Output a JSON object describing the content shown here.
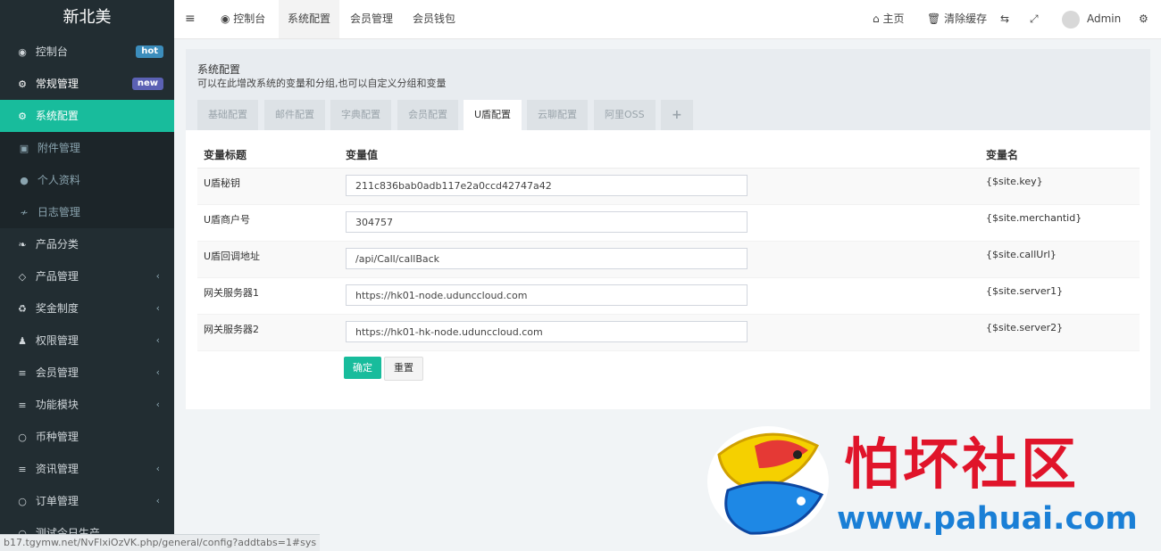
{
  "sidebar": {
    "logo": "新北美",
    "items": [
      {
        "icon": "dashboard-icon",
        "glyph": "◉",
        "label": "控制台",
        "badge": "hot"
      },
      {
        "icon": "cogs-icon",
        "glyph": "⚙",
        "label": "常规管理",
        "badge": "new"
      },
      {
        "icon": "gear-icon",
        "glyph": "⚙",
        "label": "系统配置"
      },
      {
        "icon": "file-image-icon",
        "glyph": "▣",
        "label": "附件管理"
      },
      {
        "icon": "user-icon",
        "glyph": "●",
        "label": "个人资料"
      },
      {
        "icon": "log-icon",
        "glyph": "≁",
        "label": "日志管理"
      },
      {
        "icon": "leaf-icon",
        "glyph": "❧",
        "label": "产品分类"
      },
      {
        "icon": "diamond-icon",
        "glyph": "◇",
        "label": "产品管理"
      },
      {
        "icon": "recycle-icon",
        "glyph": "♻",
        "label": "奖金制度"
      },
      {
        "icon": "group-icon",
        "glyph": "♟",
        "label": "权限管理"
      },
      {
        "icon": "list-icon",
        "glyph": "≡",
        "label": "会员管理"
      },
      {
        "icon": "list-icon",
        "glyph": "≡",
        "label": "功能模块"
      },
      {
        "icon": "circle-icon",
        "glyph": "○",
        "label": "币种管理"
      },
      {
        "icon": "list-icon",
        "glyph": "≡",
        "label": "资讯管理"
      },
      {
        "icon": "circle-icon",
        "glyph": "○",
        "label": "订单管理"
      },
      {
        "icon": "circle-icon",
        "glyph": "○",
        "label": "测试今日生产"
      }
    ],
    "status_url": "b17.tgymw.net/NvFlxiOzVK.php/general/config?addtabs=1#sys"
  },
  "topbar": {
    "tabs": [
      {
        "icon": "dashboard-icon",
        "label": "控制台"
      },
      {
        "label": "系统配置"
      },
      {
        "label": "会员管理"
      },
      {
        "label": "会员钱包"
      }
    ],
    "right": {
      "home": "主页",
      "clear_cache": "清除缓存",
      "user": "Admin"
    }
  },
  "panel": {
    "title": "系统配置",
    "subtitle": "可以在此增改系统的变量和分组,也可以自定义分组和变量",
    "tabs": [
      "基础配置",
      "邮件配置",
      "字典配置",
      "会员配置",
      "U盾配置",
      "云聊配置",
      "阿里OSS",
      "+"
    ],
    "active_tab": "U盾配置",
    "headers": {
      "title": "变量标题",
      "value": "变量值",
      "name": "变量名"
    },
    "rows": [
      {
        "title": "U盾秘钥",
        "value": "211c836bab0adb117e2a0ccd42747a42",
        "name": "{$site.key}"
      },
      {
        "title": "U盾商户号",
        "value": "304757",
        "name": "{$site.merchantid}"
      },
      {
        "title": "U盾回调地址",
        "value": "/api/Call/callBack",
        "name": "{$site.callUrl}"
      },
      {
        "title": "网关服务器1",
        "value": "https://hk01-node.udunccloud.com",
        "name": "{$site.server1}"
      },
      {
        "title": "网关服务器2",
        "value": "https://hk01-hk-node.udunccloud.com",
        "name": "{$site.server2}"
      }
    ],
    "submit_label": "确定",
    "reset_label": "重置"
  },
  "watermark": {
    "text": "怕坏社区",
    "url": "www.pahuai.com"
  },
  "colors": {
    "sidebar_bg": "#222d32",
    "accent": "#18bc9c",
    "badge_hot": "#3c8dbc",
    "badge_new": "#5b61b4",
    "watermark_red": "#e0142a",
    "watermark_blue": "#1a7fd6"
  }
}
